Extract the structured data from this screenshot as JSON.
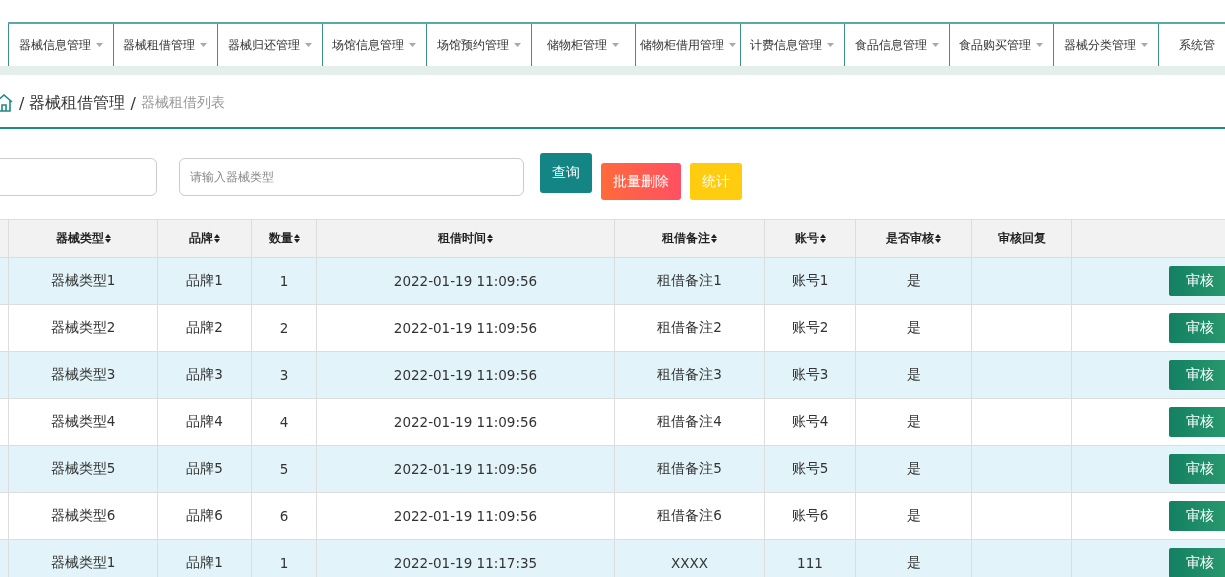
{
  "nav": [
    {
      "label": "器械信息管理"
    },
    {
      "label": "器械租借管理"
    },
    {
      "label": "器械归还管理"
    },
    {
      "label": "场馆信息管理"
    },
    {
      "label": "场馆预约管理"
    },
    {
      "label": "储物柜管理"
    },
    {
      "label": "储物柜借用管理"
    },
    {
      "label": "计费信息管理"
    },
    {
      "label": "食品信息管理"
    },
    {
      "label": "食品购买管理"
    },
    {
      "label": "器械分类管理"
    },
    {
      "label": "系统管"
    }
  ],
  "breadcrumb": {
    "separator": "/",
    "parent": "器械租借管理",
    "current": "器械租借列表"
  },
  "search": {
    "placeholder": "请输入器械类型"
  },
  "buttons": [
    {
      "label": "查询",
      "kind": "primary"
    },
    {
      "label": "批量删除",
      "kind": "danger"
    },
    {
      "label": "统计",
      "kind": "warning"
    }
  ],
  "table": {
    "columns": [
      {
        "label": "器械类型",
        "sortable": true
      },
      {
        "label": "品牌",
        "sortable": true
      },
      {
        "label": "数量",
        "sortable": true
      },
      {
        "label": "租借时间",
        "sortable": true
      },
      {
        "label": "租借备注",
        "sortable": true
      },
      {
        "label": "账号",
        "sortable": true
      },
      {
        "label": "是否审核",
        "sortable": true
      },
      {
        "label": "审核回复",
        "sortable": false
      }
    ],
    "rows": [
      {
        "cells": [
          "器械类型1",
          "品牌1",
          "1",
          "2022-01-19 11:09:56",
          "租借备注1",
          "账号1",
          "是",
          ""
        ],
        "action": "审核"
      },
      {
        "cells": [
          "器械类型2",
          "品牌2",
          "2",
          "2022-01-19 11:09:56",
          "租借备注2",
          "账号2",
          "是",
          ""
        ],
        "action": "审核"
      },
      {
        "cells": [
          "器械类型3",
          "品牌3",
          "3",
          "2022-01-19 11:09:56",
          "租借备注3",
          "账号3",
          "是",
          ""
        ],
        "action": "审核"
      },
      {
        "cells": [
          "器械类型4",
          "品牌4",
          "4",
          "2022-01-19 11:09:56",
          "租借备注4",
          "账号4",
          "是",
          ""
        ],
        "action": "审核"
      },
      {
        "cells": [
          "器械类型5",
          "品牌5",
          "5",
          "2022-01-19 11:09:56",
          "租借备注5",
          "账号5",
          "是",
          ""
        ],
        "action": "审核"
      },
      {
        "cells": [
          "器械类型6",
          "品牌6",
          "6",
          "2022-01-19 11:09:56",
          "租借备注6",
          "账号6",
          "是",
          ""
        ],
        "action": "审核"
      },
      {
        "cells": [
          "器械类型1",
          "品牌1",
          "1",
          "2022-01-19 11:17:35",
          "XXXX",
          "111",
          "是",
          ""
        ],
        "action": "审核"
      }
    ]
  }
}
